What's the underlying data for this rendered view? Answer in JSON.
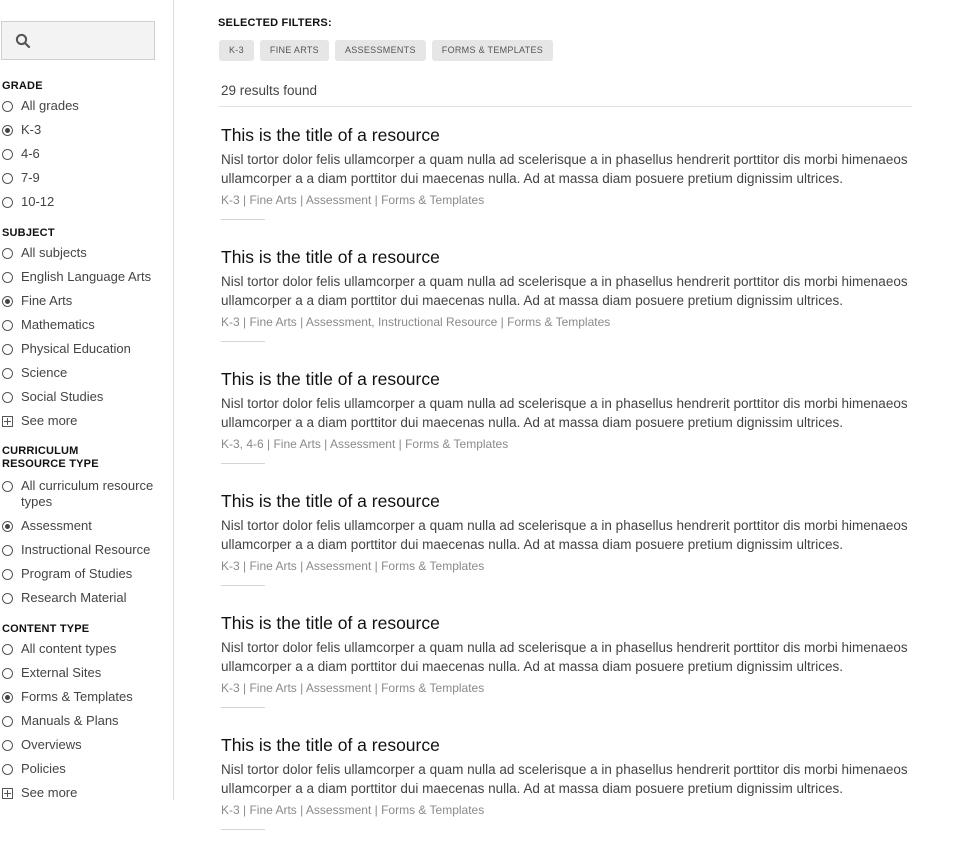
{
  "search": {
    "placeholder": "",
    "value": ""
  },
  "facets": {
    "grade": {
      "heading": "GRADE",
      "options": [
        {
          "label": "All grades",
          "checked": false
        },
        {
          "label": "K-3",
          "checked": true
        },
        {
          "label": "4-6",
          "checked": false
        },
        {
          "label": "7-9",
          "checked": false
        },
        {
          "label": "10-12",
          "checked": false
        }
      ]
    },
    "subject": {
      "heading": "SUBJECT",
      "options": [
        {
          "label": "All subjects",
          "checked": false
        },
        {
          "label": "English Language Arts",
          "checked": false
        },
        {
          "label": "Fine Arts",
          "checked": true
        },
        {
          "label": "Mathematics",
          "checked": false
        },
        {
          "label": "Physical Education",
          "checked": false
        },
        {
          "label": "Science",
          "checked": false
        },
        {
          "label": "Social Studies",
          "checked": false
        }
      ],
      "see_more": "See more"
    },
    "resource_type": {
      "heading_line1": "CURRICULUM",
      "heading_line2": "RESOURCE TYPE",
      "options": [
        {
          "label": "All curriculum resource types",
          "checked": false
        },
        {
          "label": "Assessment",
          "checked": true
        },
        {
          "label": "Instructional Resource",
          "checked": false
        },
        {
          "label": "Program of Studies",
          "checked": false
        },
        {
          "label": "Research Material",
          "checked": false
        }
      ]
    },
    "content_type": {
      "heading": "CONTENT TYPE",
      "options": [
        {
          "label": "All content types",
          "checked": false
        },
        {
          "label": "External Sites",
          "checked": false
        },
        {
          "label": "Forms & Templates",
          "checked": true
        },
        {
          "label": "Manuals & Plans",
          "checked": false
        },
        {
          "label": "Overviews",
          "checked": false
        },
        {
          "label": "Policies",
          "checked": false
        }
      ],
      "see_more": "See more"
    }
  },
  "selected_filters": {
    "title": "SELECTED FILTERS:",
    "chips": [
      "K-3",
      "FINE ARTS",
      "ASSESSMENTS",
      "FORMS & TEMPLATES"
    ]
  },
  "results": {
    "count_text": "29 results found",
    "items": [
      {
        "title": "This is the title of a resource",
        "description": "Nisl tortor dolor felis ullamcorper a quam nulla ad scelerisque a in phasellus hendrerit porttitor dis morbi himenaeos ullamcorper a a diam porttitor dui maecenas nulla. Ad at massa diam posuere pretium dignissim ultrices.",
        "meta": "K-3 | Fine Arts | Assessment | Forms & Templates"
      },
      {
        "title": "This is the title of a resource",
        "description": "Nisl tortor dolor felis ullamcorper a quam nulla ad scelerisque a in phasellus hendrerit porttitor dis morbi himenaeos ullamcorper a a diam porttitor dui maecenas nulla. Ad at massa diam posuere pretium dignissim ultrices.",
        "meta": "K-3 | Fine Arts | Assessment, Instructional Resource | Forms & Templates"
      },
      {
        "title": "This is the title of a resource",
        "description": "Nisl tortor dolor felis ullamcorper a quam nulla ad scelerisque a in phasellus hendrerit porttitor dis morbi himenaeos ullamcorper a a diam porttitor dui maecenas nulla. Ad at massa diam posuere pretium dignissim ultrices.",
        "meta": "K-3, 4-6 | Fine Arts | Assessment | Forms & Templates"
      },
      {
        "title": "This is the title of a resource",
        "description": "Nisl tortor dolor felis ullamcorper a quam nulla ad scelerisque a in phasellus hendrerit porttitor dis morbi himenaeos ullamcorper a a diam porttitor dui maecenas nulla. Ad at massa diam posuere pretium dignissim ultrices.",
        "meta": "K-3 | Fine Arts | Assessment | Forms & Templates"
      },
      {
        "title": "This is the title of a resource",
        "description": "Nisl tortor dolor felis ullamcorper a quam nulla ad scelerisque a in phasellus hendrerit porttitor dis morbi himenaeos ullamcorper a a diam porttitor dui maecenas nulla. Ad at massa diam posuere pretium dignissim ultrices.",
        "meta": "K-3 | Fine Arts | Assessment | Forms & Templates"
      },
      {
        "title": "This is the title of a resource",
        "description": "Nisl tortor dolor felis ullamcorper a quam nulla ad scelerisque a in phasellus hendrerit porttitor dis morbi himenaeos ullamcorper a a diam porttitor dui maecenas nulla. Ad at massa diam posuere pretium dignissim ultrices.",
        "meta": "K-3 | Fine Arts | Assessment | Forms & Templates"
      }
    ]
  }
}
